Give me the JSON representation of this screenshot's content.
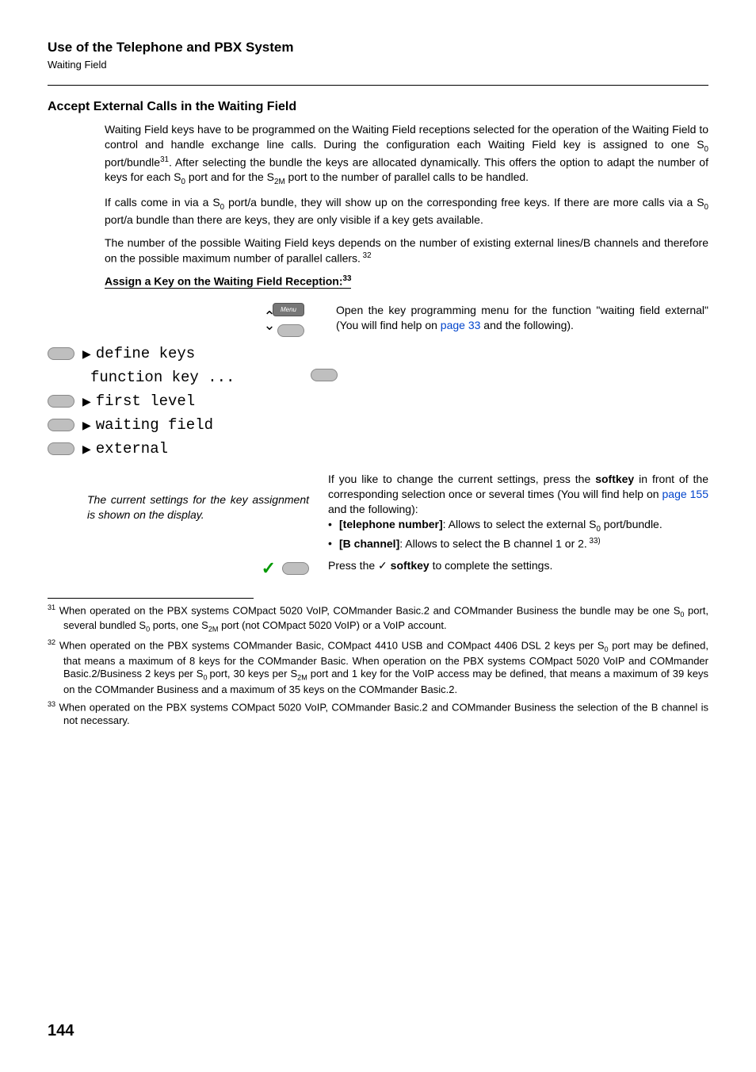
{
  "header": {
    "title": "Use of the Telephone and PBX System",
    "subtitle": "Waiting Field"
  },
  "section": {
    "heading": "Accept External Calls in the Waiting Field",
    "para1_a": "Waiting Field keys have to be programmed on the Waiting Field receptions selected for the operation of the Waiting Field to control and handle exchange line calls. During the configuration each Waiting Field key is assigned to one S",
    "para1_b": " port/bundle",
    "para1_c": ". After selecting the bundle the keys are allocated dynamically. This offers the option to adapt the number of keys for each S",
    "para1_d": " port and for the S",
    "para1_e": " port to the number of parallel calls to be handled.",
    "para2_a": "If calls come in via a S",
    "para2_b": " port/a bundle, they will show up on the corresponding free keys. If there are more calls via a S",
    "para2_c": " port/a bundle than there are keys, they are only visible if a key gets available.",
    "para3_a": "The number of the possible Waiting Field keys depends on the number of existing external lines/B channels and therefore on the possible maximum number of parallel callers.",
    "subheading": "Assign a Key on the Waiting Field Reception:",
    "step_open_a": "Open the key programming menu for the function \"waiting field external\" (You will find help on ",
    "step_open_link": "page 33",
    "step_open_b": " and the following).",
    "menu": {
      "define": "define keys",
      "function": "function key ...",
      "first": "first level",
      "waiting": "waiting field",
      "external": "external",
      "menu_label": "Menu"
    },
    "italic_note": "The current settings for the key assignment is shown on the display.",
    "settings_a": "If you like to change the current settings, press the ",
    "settings_bold1": "softkey",
    "settings_b": " in front of the corresponding selection once or several times (You will find help on ",
    "settings_link": "page 155",
    "settings_c": " and the following):",
    "bullet1_bold": "[telephone number]",
    "bullet1_text_a": ": Allows to select the external S",
    "bullet1_text_b": " port/bundle.",
    "bullet2_bold": "[B channel]",
    "bullet2_text": ": Allows to select the B channel 1 or 2.",
    "press_a": "Press the ",
    "press_check": "✓",
    "press_bold": "softkey",
    "press_b": " to complete the settings."
  },
  "footnotes": {
    "f31_a": "When operated on the PBX systems COMpact 5020 VoIP, COMmander Basic.2 and COMmander Business the bundle may be one S",
    "f31_b": " port, several bundled S",
    "f31_c": " ports, one S",
    "f31_d": " port (not COMpact 5020 VoIP) or a VoIP account.",
    "f32_a": "When operated on the PBX systems COMmander Basic, COMpact 4410 USB and COMpact 4406 DSL 2 keys per S",
    "f32_b": " port may be defined, that means a maximum of 8 keys for the COMmander Basic. When operation on the PBX systems COMpact 5020 VoIP and COMmander Basic.2/Business 2 keys per S",
    "f32_c": " port, 30 keys per S",
    "f32_d": " port and 1 key for the VoIP access may be defined, that means a maximum of 39 keys on the COMmander Business and a maximum of 35 keys on the COMmander Basic.2.",
    "f33": "When operated on the PBX systems COMpact 5020 VoIP, COMmander Basic.2 and COMmander Business the selection of the B channel is not necessary."
  },
  "page_number": "144"
}
